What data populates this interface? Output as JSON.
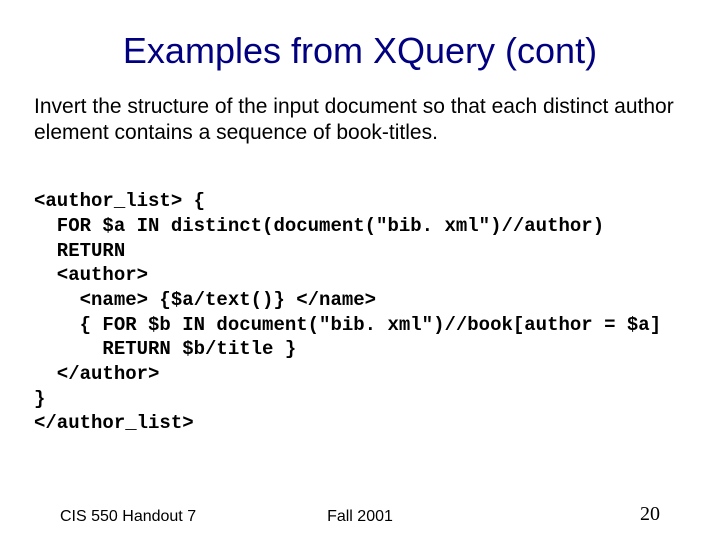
{
  "title": "Examples from XQuery (cont)",
  "body": "Invert the structure of the input document so that each distinct author element contains a sequence of book-titles.",
  "code": {
    "l1": "<author_list> {",
    "l2": "  FOR $a IN distinct(document(\"bib. xml\")//author)",
    "l3": "  RETURN",
    "l4": "  <author>",
    "l5": "    <name> {$a/text()} </name>",
    "l6": "    { FOR $b IN document(\"bib. xml\")//book[author = $a]",
    "l7": "      RETURN $b/title }",
    "l8": "  </author>",
    "l9": "}",
    "l10": "</author_list>"
  },
  "footer": {
    "left": "CIS 550 Handout 7",
    "center": "Fall 2001",
    "right": "20"
  }
}
